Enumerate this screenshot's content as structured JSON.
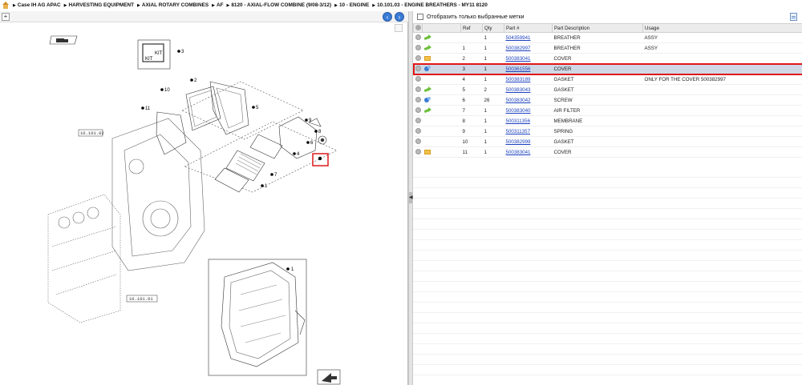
{
  "breadcrumb": [
    "Case IH AG APAC",
    "HARVESTING EQUIPMENT",
    "AXIAL ROTARY COMBINES",
    "AF",
    "8120 - AXIAL-FLOW COMBINE (9/08-3/12)",
    "10 - ENGINE",
    "10.101.03 - ENGINE BREATHERS - MY11 8120"
  ],
  "filter": {
    "label": "Отобразить только выбранные метки",
    "checked": false
  },
  "table": {
    "columns": [
      "Ref",
      "Qty",
      "Part #",
      "Part Description",
      "Usage"
    ],
    "rows": [
      {
        "icon": "green-arrow-icon",
        "ref": "",
        "qty": "1",
        "part": "504359941",
        "desc": "BREATHER",
        "usage": "ASSY",
        "selected": false
      },
      {
        "icon": "green-arrow-icon",
        "ref": "1",
        "qty": "1",
        "part": "500382997",
        "desc": "BREATHER",
        "usage": "ASSY",
        "selected": false
      },
      {
        "icon": "folder-icon",
        "ref": "2",
        "qty": "1",
        "part": "500383041",
        "desc": "COVER",
        "usage": "",
        "selected": false
      },
      {
        "icon": "blue-parts-icon",
        "ref": "3",
        "qty": "1",
        "part": "500361556",
        "desc": "COVER",
        "usage": "",
        "selected": true
      },
      {
        "icon": "",
        "ref": "4",
        "qty": "1",
        "part": "500383189",
        "desc": "GASKET",
        "usage": "ONLY FOR THE COVER 500382997",
        "selected": false
      },
      {
        "icon": "green-arrow-icon",
        "ref": "5",
        "qty": "2",
        "part": "500383043",
        "desc": "GASKET",
        "usage": "",
        "selected": false
      },
      {
        "icon": "blue-parts-icon",
        "ref": "6",
        "qty": "26",
        "part": "500383042",
        "desc": "SCREW",
        "usage": "",
        "selected": false
      },
      {
        "icon": "green-arrow-icon",
        "ref": "7",
        "qty": "1",
        "part": "500383040",
        "desc": "AIR FILTER",
        "usage": "",
        "selected": false
      },
      {
        "icon": "",
        "ref": "8",
        "qty": "1",
        "part": "500311356",
        "desc": "MEMBRANE",
        "usage": "",
        "selected": false
      },
      {
        "icon": "",
        "ref": "9",
        "qty": "1",
        "part": "500311357",
        "desc": "SPRING",
        "usage": "",
        "selected": false
      },
      {
        "icon": "",
        "ref": "10",
        "qty": "1",
        "part": "500382999",
        "desc": "GASKET",
        "usage": "",
        "selected": false
      },
      {
        "icon": "folder-icon",
        "ref": "11",
        "qty": "1",
        "part": "500383041",
        "desc": "COVER",
        "usage": "",
        "selected": false
      }
    ]
  },
  "diagram": {
    "kit_label": "KIT",
    "callouts": [
      "3",
      "2",
      "10",
      "11",
      "5",
      "9",
      "8",
      "6",
      "4",
      "7",
      "1",
      "1"
    ],
    "ref_tags": [
      "10.101.02",
      "10.101.01"
    ]
  },
  "colors": {
    "highlight": "#e01818",
    "selected_row": "#cfd8e4",
    "link": "#1a3fbf"
  }
}
